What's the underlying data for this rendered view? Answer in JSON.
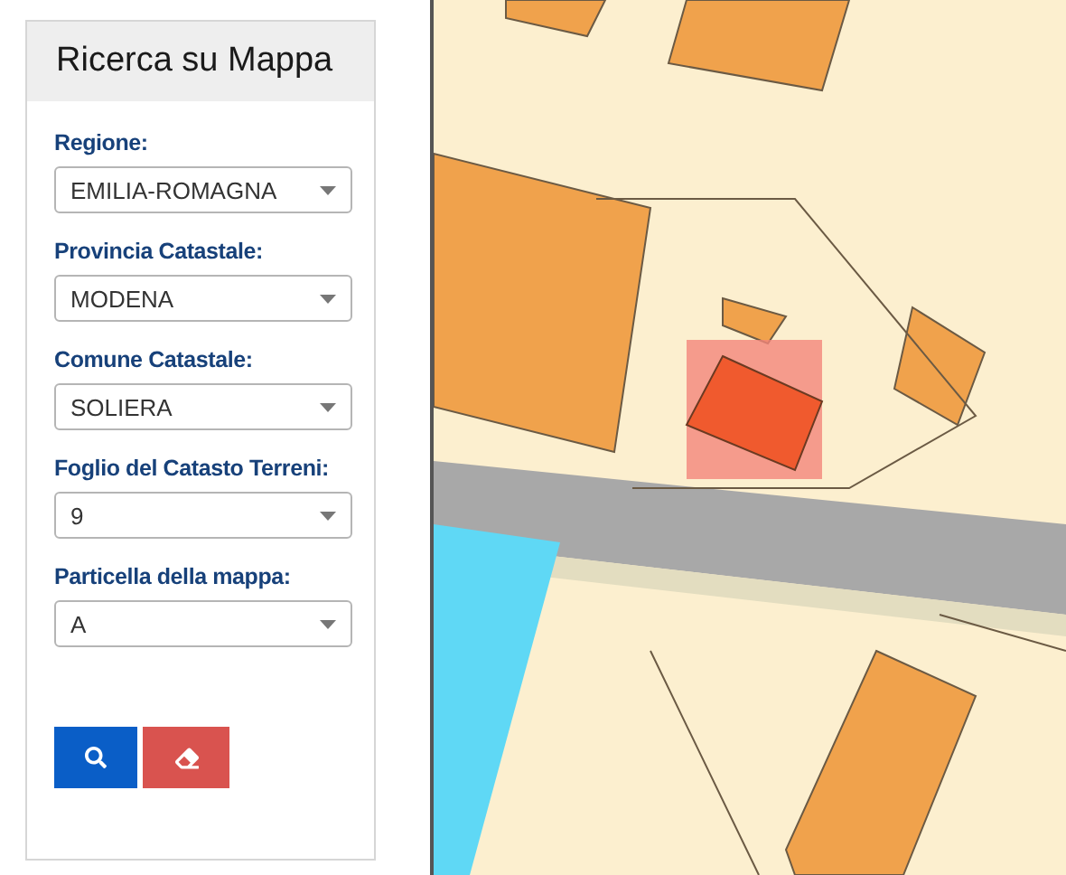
{
  "panel": {
    "title": "Ricerca su Mappa",
    "fields": [
      {
        "label": "Regione:",
        "value": "EMILIA-ROMAGNA"
      },
      {
        "label": "Provincia Catastale:",
        "value": "MODENA"
      },
      {
        "label": "Comune Catastale:",
        "value": "SOLIERA"
      },
      {
        "label": "Foglio del Catasto Terreni:",
        "value": "9"
      },
      {
        "label": "Particella della mappa:",
        "value": "A"
      }
    ],
    "buttons": [
      {
        "kind": "search"
      },
      {
        "kind": "clear"
      }
    ]
  }
}
